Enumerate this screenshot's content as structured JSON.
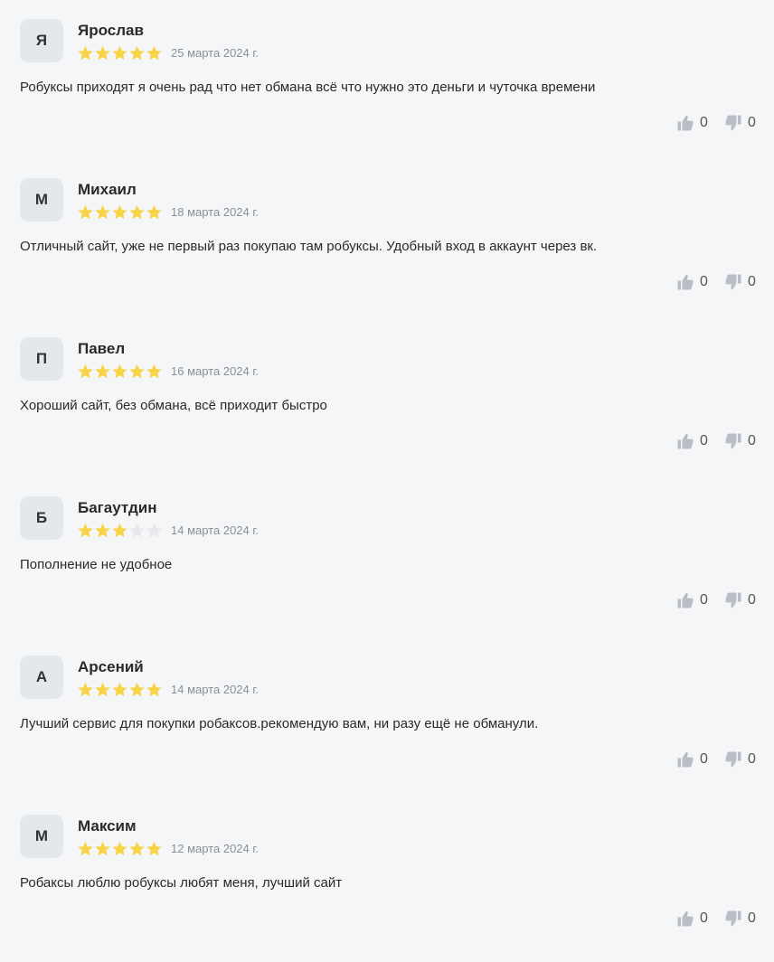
{
  "colors": {
    "star_filled": "#f7d346",
    "star_empty": "#e6e8ec",
    "avatar_bg": "#e4e7ec",
    "vote_icon": "#b9bec6",
    "page_bg": "#f5f6f8"
  },
  "reviews": [
    {
      "initial": "Я",
      "author": "Ярослав",
      "rating": 5,
      "date": "25 марта 2024 г.",
      "text": "Робуксы приходят я очень рад что нет обмана всё что нужно это деньги и чуточка времени",
      "likes": "0",
      "dislikes": "0"
    },
    {
      "initial": "М",
      "author": "Михаил",
      "rating": 5,
      "date": "18 марта 2024 г.",
      "text": "Отличный сайт, уже не первый раз покупаю там робуксы. Удобный вход в аккаунт через вк.",
      "likes": "0",
      "dislikes": "0"
    },
    {
      "initial": "П",
      "author": "Павел",
      "rating": 5,
      "date": "16 марта 2024 г.",
      "text": "Хороший сайт, без обмана, всё приходит быстро",
      "likes": "0",
      "dislikes": "0"
    },
    {
      "initial": "Б",
      "author": "Багаутдин",
      "rating": 3,
      "date": "14 марта 2024 г.",
      "text": "Пополнение не удобное",
      "likes": "0",
      "dislikes": "0"
    },
    {
      "initial": "А",
      "author": "Арсений",
      "rating": 5,
      "date": "14 марта 2024 г.",
      "text": "Лучший сервис для покупки робаксов.рекомендую вам, ни разу ещё не обманули.",
      "likes": "0",
      "dislikes": "0"
    },
    {
      "initial": "М",
      "author": "Максим",
      "rating": 5,
      "date": "12 марта 2024 г.",
      "text": "Робаксы люблю робуксы любят меня, лучший сайт",
      "likes": "0",
      "dislikes": "0"
    }
  ]
}
